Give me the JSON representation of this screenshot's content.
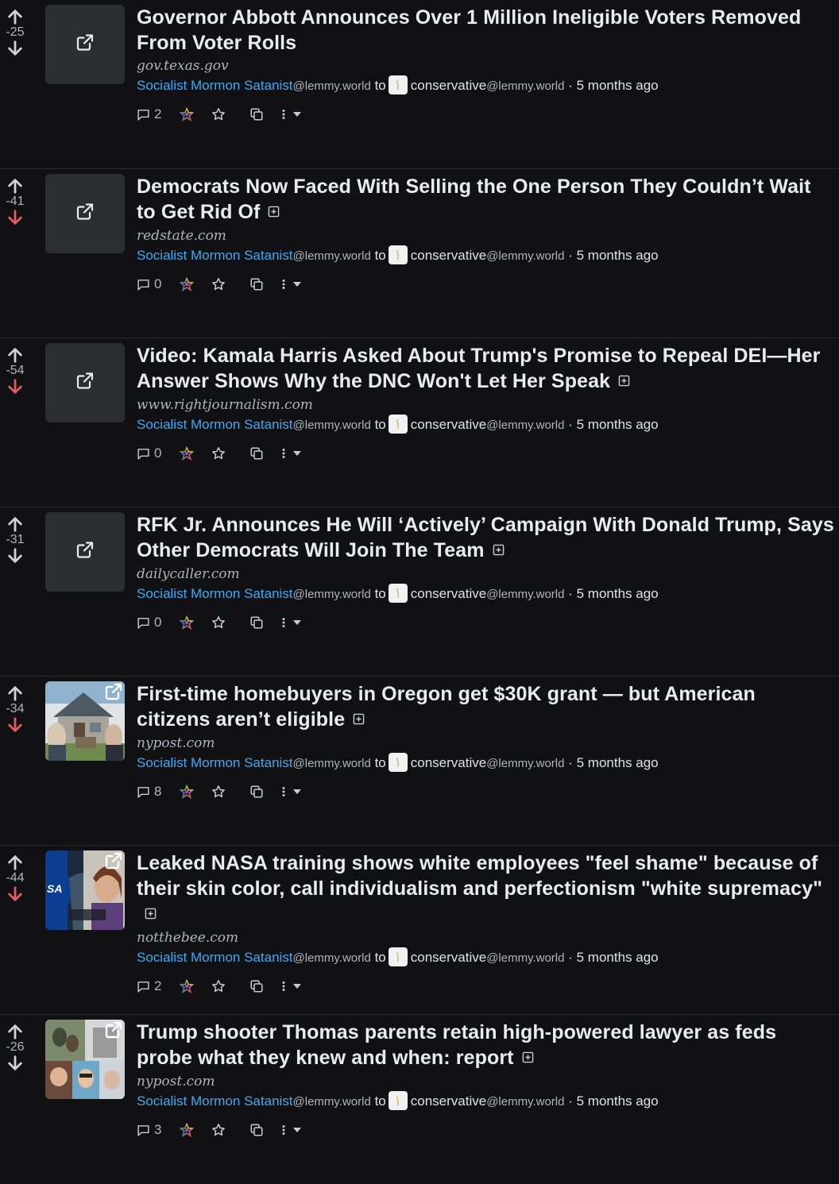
{
  "posts": [
    {
      "score": "-25",
      "downvoted": false,
      "title": "Governor Abbott Announces Over 1 Million Ineligible Voters Removed From Voter Rolls",
      "has_expand": false,
      "domain": "gov.texas.gov",
      "author": "Socialist Mormon Satanist",
      "author_instance": "@lemmy.world",
      "to_label": "to",
      "community": "conservative",
      "community_instance": "@lemmy.world",
      "separator": "·",
      "time": "5 months ago",
      "comments": "2",
      "thumb": "none"
    },
    {
      "score": "-41",
      "downvoted": true,
      "title": "Democrats Now Faced With Selling the One Person They Couldn’t Wait to Get Rid Of",
      "has_expand": true,
      "domain": "redstate.com",
      "author": "Socialist Mormon Satanist",
      "author_instance": "@lemmy.world",
      "to_label": "to",
      "community": "conservative",
      "community_instance": "@lemmy.world",
      "separator": "·",
      "time": "5 months ago",
      "comments": "0",
      "thumb": "none"
    },
    {
      "score": "-54",
      "downvoted": true,
      "title": "Video: Kamala Harris Asked About Trump's Promise to Repeal DEI—Her Answer Shows Why the DNC Won't Let Her Speak",
      "has_expand": true,
      "domain": "www.rightjournalism.com",
      "author": "Socialist Mormon Satanist",
      "author_instance": "@lemmy.world",
      "to_label": "to",
      "community": "conservative",
      "community_instance": "@lemmy.world",
      "separator": "·",
      "time": "5 months ago",
      "comments": "0",
      "thumb": "none"
    },
    {
      "score": "-31",
      "downvoted": false,
      "title": "RFK Jr. Announces He Will ‘Actively’ Campaign With Donald Trump, Says Other Democrats Will Join The Team",
      "has_expand": true,
      "domain": "dailycaller.com",
      "author": "Socialist Mormon Satanist",
      "author_instance": "@lemmy.world",
      "to_label": "to",
      "community": "conservative",
      "community_instance": "@lemmy.world",
      "separator": "·",
      "time": "5 months ago",
      "comments": "0",
      "thumb": "none"
    },
    {
      "score": "-34",
      "downvoted": true,
      "title": "First-time homebuyers in Oregon get $30K grant — but American citizens aren’t eligible",
      "has_expand": true,
      "domain": "nypost.com",
      "author": "Socialist Mormon Satanist",
      "author_instance": "@lemmy.world",
      "to_label": "to",
      "community": "conservative",
      "community_instance": "@lemmy.world",
      "separator": "·",
      "time": "5 months ago",
      "comments": "8",
      "thumb": "house"
    },
    {
      "score": "-44",
      "downvoted": true,
      "title": "Leaked NASA training shows white employees \"feel shame\" because of their skin color, call individualism and perfectionism \"white supremacy\"",
      "has_expand": true,
      "domain": "notthebee.com",
      "author": "Socialist Mormon Satanist",
      "author_instance": "@lemmy.world",
      "to_label": "to",
      "community": "conservative",
      "community_instance": "@lemmy.world",
      "separator": "·",
      "time": "5 months ago",
      "comments": "2",
      "thumb": "nasa",
      "thumb_text": "SA"
    },
    {
      "score": "-26",
      "downvoted": false,
      "title": "Trump shooter Thomas parents retain high-powered lawyer as feds probe what they knew and when: report",
      "has_expand": true,
      "domain": "nypost.com",
      "author": "Socialist Mormon Satanist",
      "author_instance": "@lemmy.world",
      "to_label": "to",
      "community": "conservative",
      "community_instance": "@lemmy.world",
      "separator": "·",
      "time": "5 months ago",
      "comments": "3",
      "thumb": "collage"
    }
  ],
  "icons": {
    "upvote": "arrow-up-icon",
    "downvote": "arrow-down-icon",
    "external": "external-link-icon",
    "expand": "plus-square-icon",
    "comments": "message-square-icon",
    "federation": "fediverse-star-icon",
    "save": "star-icon",
    "crosspost": "copy-icon",
    "more": "more-vertical-icon",
    "dropdown": "caret-down-icon"
  },
  "colors": {
    "background": "#111113",
    "link": "#3fa9f5",
    "downvote_active": "#e35d5d",
    "muted": "#adb5bd"
  }
}
